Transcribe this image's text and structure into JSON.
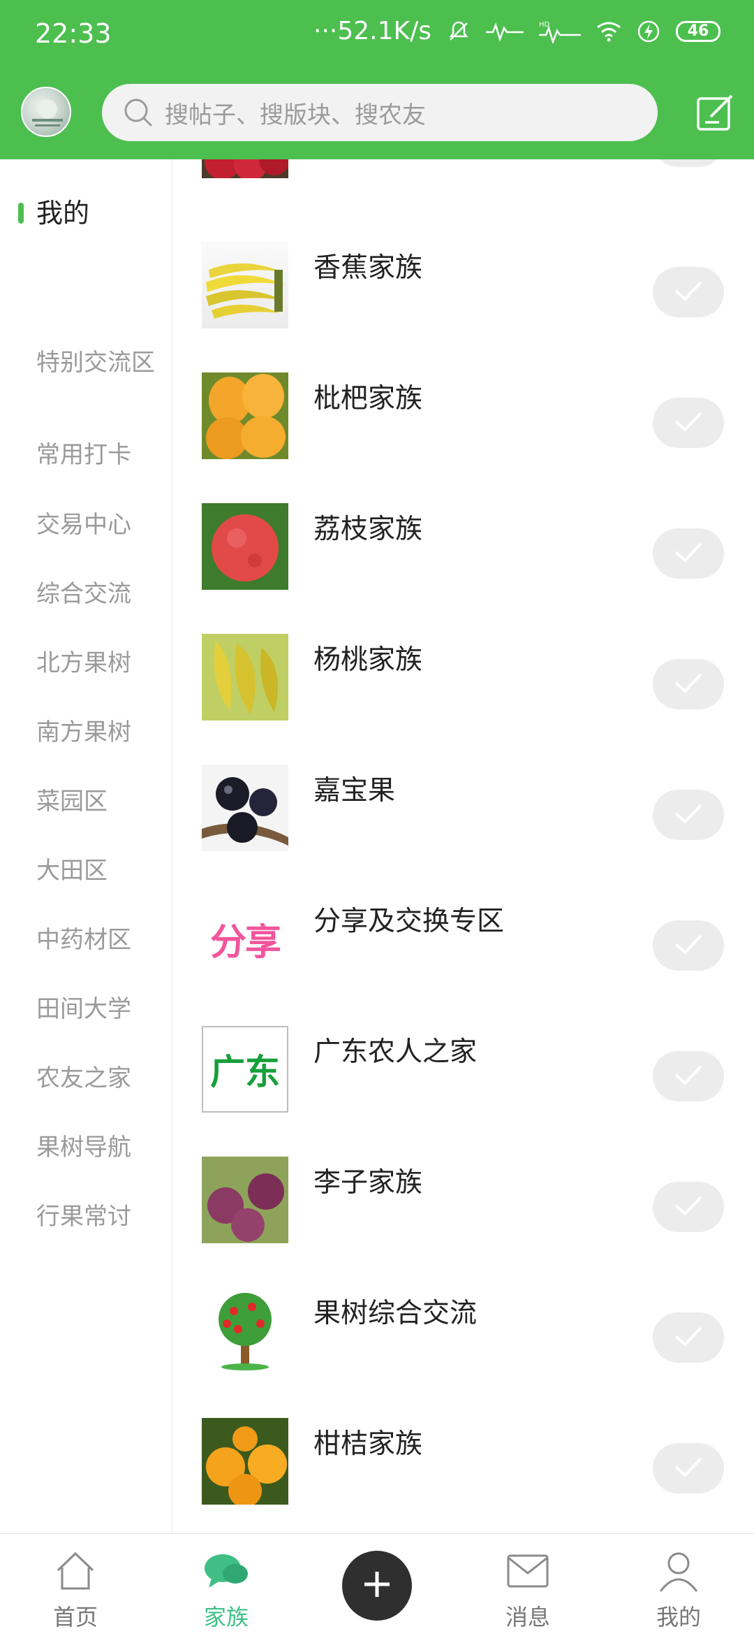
{
  "status_bar": {
    "time": "22:33",
    "network_speed": "···52.1K/s",
    "battery": "46"
  },
  "header": {
    "search_placeholder": "搜帖子、搜版块、搜农友",
    "accent_color": "#4cbf4f"
  },
  "sidebar": {
    "items": [
      {
        "label": "我的",
        "active": true
      },
      {
        "label": "特别交流区"
      },
      {
        "label": "常用打卡"
      },
      {
        "label": "交易中心"
      },
      {
        "label": "综合交流"
      },
      {
        "label": "北方果树"
      },
      {
        "label": "南方果树"
      },
      {
        "label": "菜园区"
      },
      {
        "label": "大田区"
      },
      {
        "label": "中药材区"
      },
      {
        "label": "田间大学"
      },
      {
        "label": "农友之家"
      },
      {
        "label": "果树导航"
      },
      {
        "label": "行果常讨"
      }
    ]
  },
  "list": {
    "items": [
      {
        "title": "",
        "icon": "fruit-red-thumbnail"
      },
      {
        "title": "香蕉家族",
        "icon": "banana-thumbnail"
      },
      {
        "title": "枇杷家族",
        "icon": "loquat-thumbnail"
      },
      {
        "title": "荔枝家族",
        "icon": "lychee-thumbnail"
      },
      {
        "title": "杨桃家族",
        "icon": "starfruit-thumbnail"
      },
      {
        "title": "嘉宝果",
        "icon": "jabuticaba-thumbnail"
      },
      {
        "title": "分享及交换专区",
        "icon": "share-thumbnail",
        "thumb_text": "分享"
      },
      {
        "title": "广东农人之家",
        "icon": "guangdong-thumbnail",
        "thumb_text": "广东"
      },
      {
        "title": "李子家族",
        "icon": "plum-thumbnail"
      },
      {
        "title": "果树综合交流",
        "icon": "fruit-tree-thumbnail"
      },
      {
        "title": "柑桔家族",
        "icon": "citrus-thumbnail"
      }
    ]
  },
  "bottom_nav": {
    "items": [
      {
        "label": "首页",
        "icon": "home-icon"
      },
      {
        "label": "家族",
        "icon": "chat-bubbles-icon",
        "active": true
      },
      {
        "label": "",
        "icon": "plus-icon"
      },
      {
        "label": "消息",
        "icon": "mail-icon"
      },
      {
        "label": "我的",
        "icon": "person-icon"
      }
    ],
    "active_color": "#3fbf85"
  }
}
